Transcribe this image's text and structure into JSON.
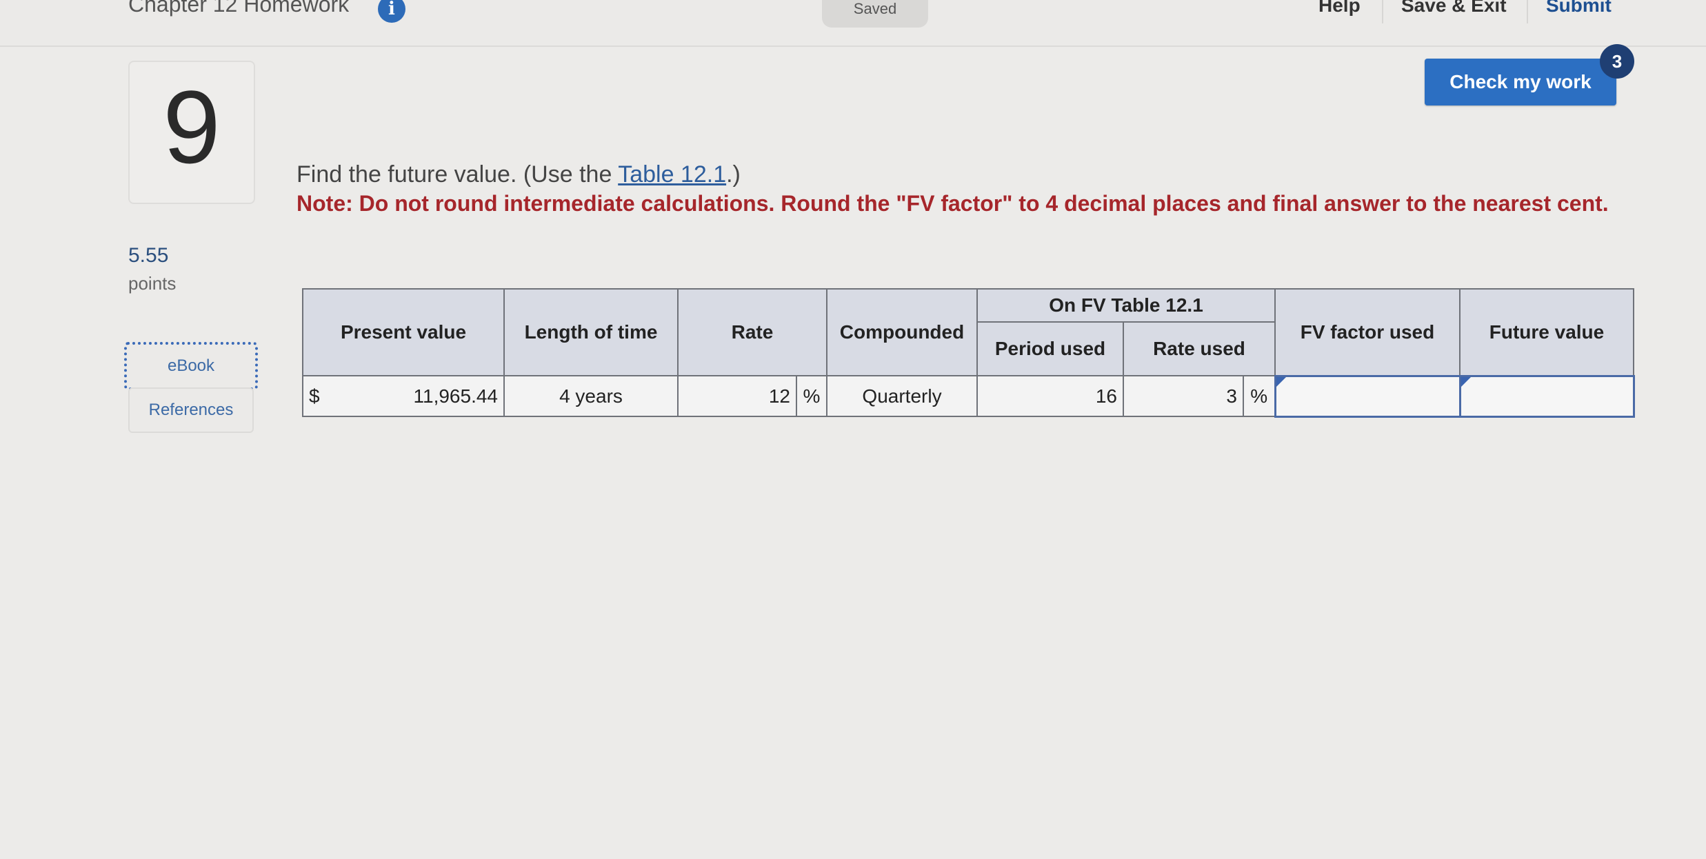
{
  "header": {
    "assignment_title": "Chapter 12 Homework",
    "info_badge": "i",
    "saved_label": "Saved",
    "help_label": "Help",
    "save_exit_label": "Save & Exit",
    "submit_label": "Submit"
  },
  "check_work": {
    "label": "Check my work",
    "count": "3"
  },
  "question": {
    "number": "9",
    "points_value": "5.55",
    "points_label": "points",
    "ebook_label": "eBook",
    "references_label": "References",
    "prompt_before": "Find the future value. (Use the ",
    "prompt_link": "Table 12.1",
    "prompt_after": ".)",
    "note": "Note: Do not round intermediate calculations. Round the \"FV factor\" to 4 decimal places and final answer to the nearest cent."
  },
  "table": {
    "headers": {
      "present_value": "Present value",
      "length_of_time": "Length of time",
      "rate": "Rate",
      "compounded": "Compounded",
      "group": "On FV Table 12.1",
      "period_used": "Period used",
      "rate_used": "Rate used",
      "fv_factor_used": "FV factor used",
      "future_value": "Future value"
    },
    "row": {
      "currency_symbol": "$",
      "present_value": "11,965.44",
      "length_of_time": "4 years",
      "rate": "12",
      "rate_unit": "%",
      "compounded": "Quarterly",
      "period_used": "16",
      "rate_used": "3",
      "rate_used_unit": "%",
      "fv_factor_used": "",
      "future_value": ""
    }
  },
  "colors": {
    "primary_button": "#2c6fc2",
    "note_red": "#a6262b",
    "header_bg": "#d8dbe4",
    "link_blue": "#2d5d9c"
  }
}
